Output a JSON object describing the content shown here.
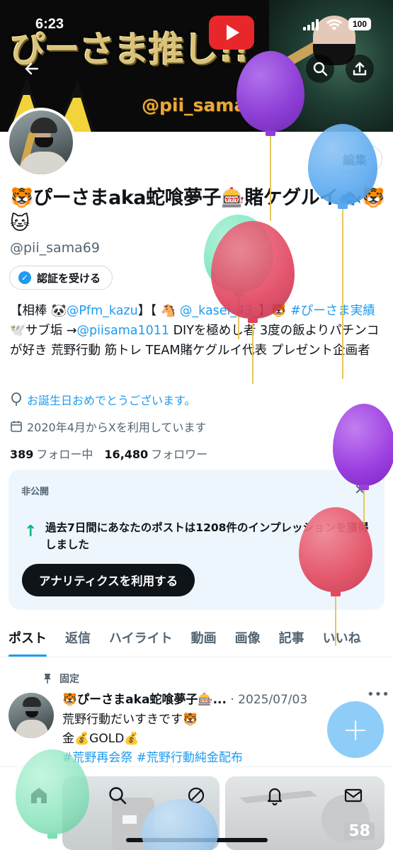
{
  "status_bar": {
    "time": "6:23",
    "battery": "100"
  },
  "banner": {
    "title_text": "ぴーさま推し!!",
    "handle_text": "@pii_sama69"
  },
  "profile": {
    "edit_label": "編集",
    "display_name": "🐯ぴーさまaka蛇喰夢子🎰賭ケグルイ🐟🐯🐱",
    "handle": "@pii_sama69",
    "verify_label": "認証を受ける",
    "bio": {
      "p1": "【相棒 🐼",
      "p2": "@Pfm_kazu",
      "p3": "】【 🐴 ",
      "p4": "@_kasei_43_",
      "p5": "】🐯 ",
      "p6": "#ぴーさま実績",
      "p7": "🕊️サブ垢 →",
      "p8": "@piisama1011",
      "p9": " DIYを極めし者 3度の飯よりパチンコが好き 荒野行動 筋トレ TEAM賭ケグルイ代表 プレゼント企画者"
    },
    "birthday_text": "お誕生日おめでとうございます。",
    "joined_text": "2020年4月からXを利用しています",
    "following_count": "389",
    "following_label": "フォロー中",
    "followers_count": "16,480",
    "followers_label": "フォロワー"
  },
  "analytics_card": {
    "private_label": "非公開",
    "message": "過去7日間にあなたのポストは1208件のインプレッションを獲得しました",
    "button_label": "アナリティクスを利用する"
  },
  "tabs": [
    "ポスト",
    "返信",
    "ハイライト",
    "動画",
    "画像",
    "記事",
    "いいね"
  ],
  "pinned_post": {
    "pinned_label": "固定",
    "author": "🐯ぴーさまaka蛇喰夢子🎰...",
    "date": "· 2025/07/03",
    "line1": "荒野行動だいすきです🐯",
    "line2": "金💰GOLD💰",
    "line3": "#荒野再会祭 #荒野行動純金配布",
    "image_badge": "58"
  },
  "colors": {
    "accent": "#1d9bf0",
    "text_primary": "#0f1419",
    "text_secondary": "#536471",
    "card_bg": "#eef6fd",
    "fab": "#8ecdf8"
  },
  "balloons": [
    {
      "color": "#8f3fd6"
    },
    {
      "color": "#5aa9f0"
    },
    {
      "color": "#6ee3b8"
    },
    {
      "color": "#e0415c"
    },
    {
      "color": "#9b3ee0"
    },
    {
      "color": "#e34a5f"
    },
    {
      "color": "#7be0b4"
    },
    {
      "color": "#9fcdf3"
    }
  ]
}
